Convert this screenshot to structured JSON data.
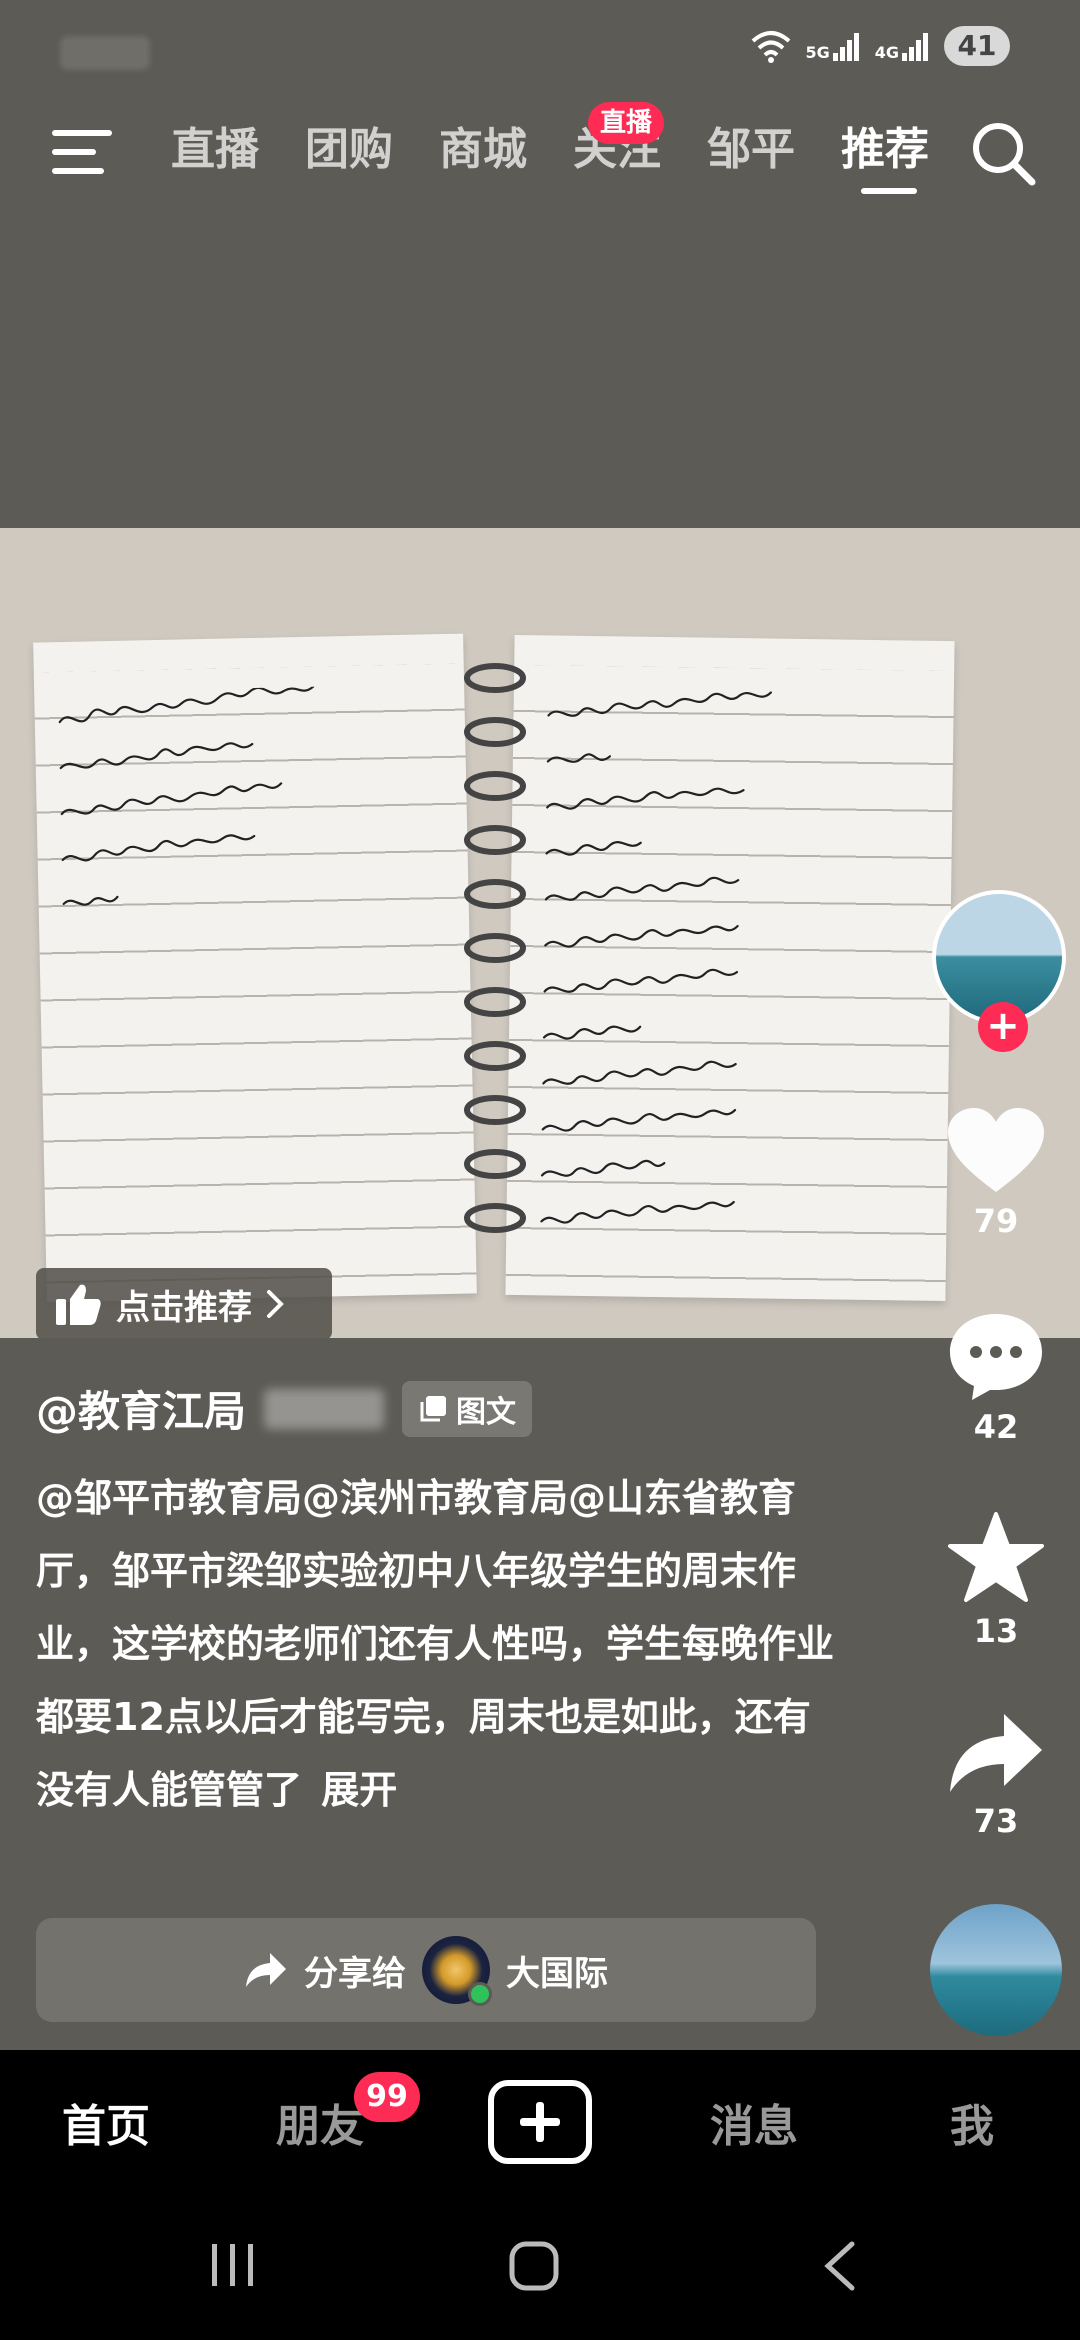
{
  "status_bar": {
    "net_5g": "5G",
    "net_4g": "4G",
    "battery": "41"
  },
  "top_nav": {
    "tabs": [
      {
        "label": "直播"
      },
      {
        "label": "团购"
      },
      {
        "label": "商城"
      },
      {
        "label": "关注"
      },
      {
        "label": "邹平"
      },
      {
        "label": "推荐"
      }
    ],
    "active_tab": "推荐",
    "follow_badge": "直播"
  },
  "photo": {
    "recommend_label": "点击推荐"
  },
  "post": {
    "author": "@教育江局",
    "tag": "图文",
    "caption": "@邹平市教育局@滨州市教育局@山东省教育厅，邹平市梁邹实验初中八年级学生的周末作业，这学校的老师们还有人性吗，学生每晚作业都要12点以后才能写完，周末也是如此，还有没有人能管管了",
    "expand": "展开"
  },
  "rail": {
    "like_count": "79",
    "comment_count": "42",
    "favorite_count": "13",
    "share_count": "73"
  },
  "share_bar": {
    "label": "分享给",
    "recipient": "大国际"
  },
  "bottom_nav": {
    "home": "首页",
    "friends": "朋友",
    "friends_badge": "99",
    "messages": "消息",
    "me": "我"
  },
  "colors": {
    "accent": "#fe2c55",
    "background": "#5d5b55",
    "online": "#30c25a"
  }
}
